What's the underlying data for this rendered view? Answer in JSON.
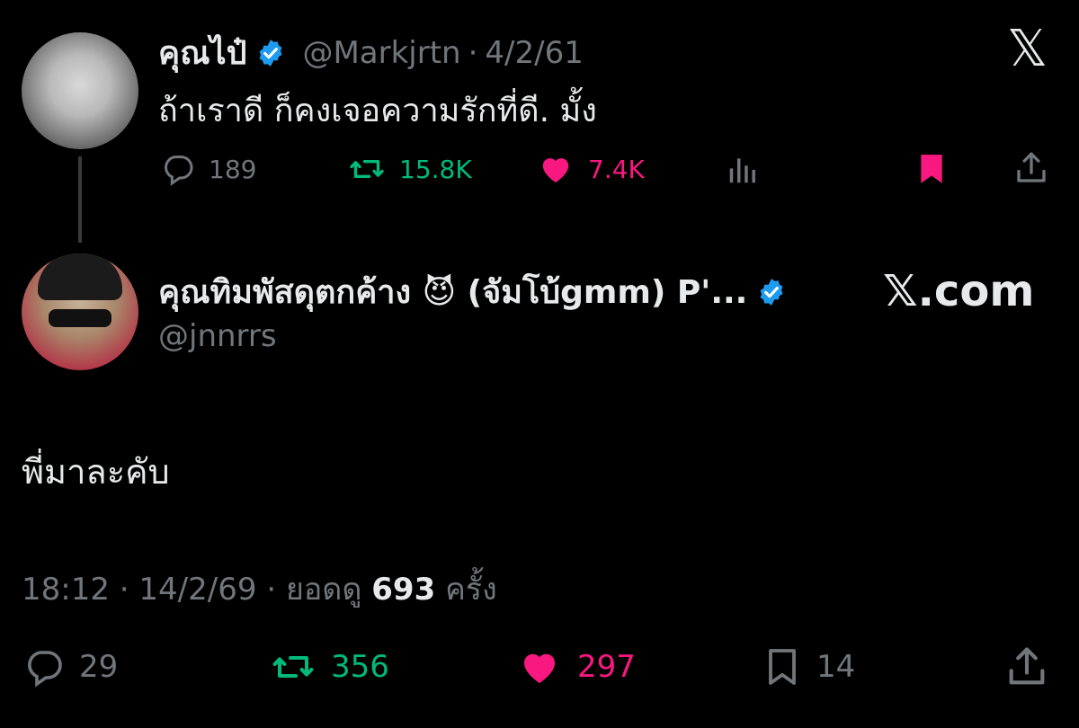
{
  "quoted_tweet": {
    "display_name": "คุณไป๋",
    "handle": "@Markjrtn",
    "separator": "·",
    "date": "4/2/61",
    "text": "ถ้าเราดี ก็คงเจอความรักที่ดี.  มั้ง",
    "stats": {
      "replies": "189",
      "retweets": "15.8K",
      "likes": "7.4K"
    }
  },
  "reply_tweet": {
    "display_name": "คุณทิมพัสดุตกค้าง 😈 (จัมโบ้gmm) P'...",
    "handle": "@jnnrrs",
    "text": "พี่มาละคับ",
    "time": "18:12",
    "date": "14/2/69",
    "views_prefix": "ยอดดู",
    "views": "693",
    "views_suffix": "ครั้ง",
    "stats": {
      "replies": "29",
      "retweets": "356",
      "likes": "297",
      "bookmarks": "14"
    }
  },
  "watermark": {
    "top_logo": "𝕏",
    "site": "𝕏.com"
  },
  "colors": {
    "background": "#000000",
    "text": "#e7e9ea",
    "muted": "#71767b",
    "verified": "#1d9bf0",
    "retweet": "#00ba7c",
    "like": "#f91880"
  }
}
